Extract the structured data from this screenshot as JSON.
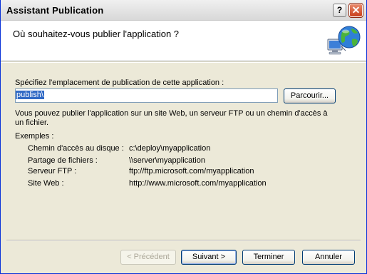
{
  "window": {
    "title": "Assistant Publication"
  },
  "header": {
    "title": "Où souhaitez-vous publier l'application ?"
  },
  "location": {
    "label": "Spécifiez l'emplacement de publication de cette application :",
    "value": "publish\\",
    "browse_label": "Parcourir..."
  },
  "description": "Vous pouvez publier l'application sur un site Web, un serveur FTP ou un chemin d'accès à un fichier.",
  "examples": {
    "title": "Exemples :",
    "rows": [
      {
        "label": "Chemin d'accès au disque :",
        "value": "c:\\deploy\\myapplication"
      },
      {
        "label": "Partage de fichiers :",
        "value": "\\\\server\\myapplication"
      },
      {
        "label": "Serveur FTP :",
        "value": "ftp://ftp.microsoft.com/myapplication"
      },
      {
        "label": "Site Web :",
        "value": "http://www.microsoft.com/myapplication"
      }
    ]
  },
  "buttons": {
    "previous": "< Précédent",
    "next": "Suivant >",
    "finish": "Terminer",
    "cancel": "Annuler"
  },
  "icons": {
    "help": "?",
    "close": "✕"
  }
}
